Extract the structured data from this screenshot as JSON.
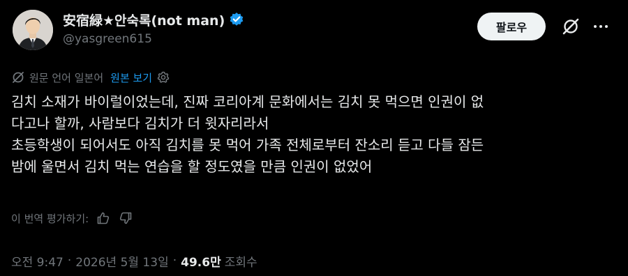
{
  "author": {
    "display_name": "安宿緑★안숙록(not man)",
    "handle": "@yasgreen615",
    "verified": true
  },
  "header": {
    "follow_label": "팔로우",
    "grok_icon": "grok-slash-icon",
    "more_icon": "more-dots-icon"
  },
  "translation": {
    "note": "원문 언어 일본어",
    "show_original_label": "원본 보기",
    "globe_icon": "translate-globe-icon",
    "settings_icon": "gear-icon"
  },
  "tweet": {
    "lines": [
      "김치 소재가 바이럴이었는데, 진짜 코리아계 문화에서는 김치 못 먹으면 인권이 없",
      "다고나 할까, 사람보다 김치가 더 윗자리라서",
      "초등학생이 되어서도 아직 김치를 못 먹어 가족 전체로부터 잔소리 듣고 다들 잠든",
      "밤에 울면서 김치 먹는 연습을 할 정도였을 만큼 인권이 없었어"
    ]
  },
  "rating": {
    "label": "이 번역 평가하기:",
    "like_icon": "thumbs-up-icon",
    "dislike_icon": "thumbs-down-icon"
  },
  "meta": {
    "time": "오전 9:47",
    "separator": "·",
    "date": "2026년 5월 13일",
    "views_count": "49.6만",
    "views_label": "조회수"
  },
  "colors": {
    "background": "#000000",
    "text_primary": "#e7e9ea",
    "text_secondary": "#71767b",
    "accent": "#1d9bf0",
    "follow_bg": "#eff3f4"
  }
}
